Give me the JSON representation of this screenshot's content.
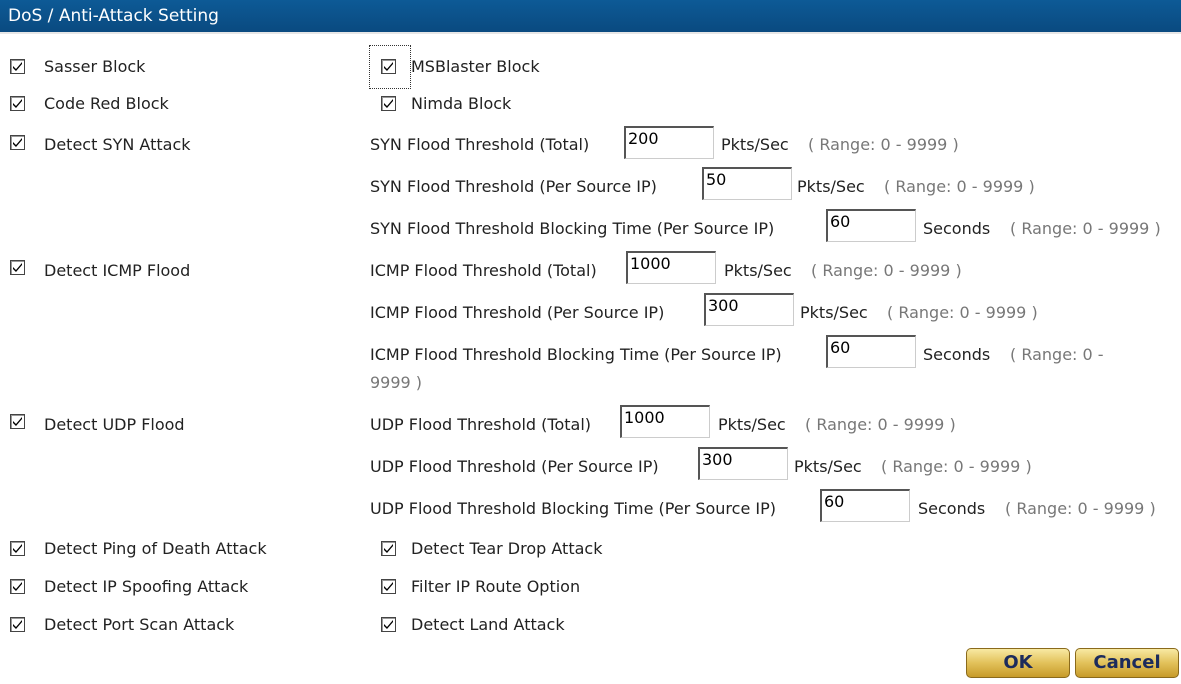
{
  "header": {
    "title": "DoS / Anti-Attack Setting"
  },
  "checks": {
    "sasser": "Sasser Block",
    "msblaster": "MSBlaster Block",
    "codered": "Code Red Block",
    "nimda": "Nimda Block",
    "syn": "Detect SYN Attack",
    "icmp": "Detect ICMP Flood",
    "udp": "Detect UDP Flood",
    "pingofdeath": "Detect Ping of Death Attack",
    "teardrop": "Detect Tear Drop Attack",
    "ipspoof": "Detect IP Spoofing Attack",
    "iproute": "Filter IP Route Option",
    "portscan": "Detect Port Scan Attack",
    "land": "Detect Land Attack"
  },
  "syn": {
    "total_label": "SYN Flood Threshold (Total)",
    "total_value": "200",
    "total_unit": "Pkts/Sec",
    "total_range": "( Range: 0 - 9999 )",
    "persrc_label": "SYN Flood Threshold (Per Source IP)",
    "persrc_value": "50",
    "persrc_unit": "Pkts/Sec",
    "persrc_range": "( Range: 0 - 9999 )",
    "block_label": "SYN Flood Threshold Blocking Time (Per Source IP)",
    "block_value": "60",
    "block_unit": "Seconds",
    "block_range": "( Range: 0 - 9999 )"
  },
  "icmp": {
    "total_label": "ICMP Flood Threshold (Total)",
    "total_value": "1000",
    "total_unit": "Pkts/Sec",
    "total_range": "( Range: 0 - 9999 )",
    "persrc_label": "ICMP Flood Threshold (Per Source IP)",
    "persrc_value": "300",
    "persrc_unit": "Pkts/Sec",
    "persrc_range": "( Range: 0 - 9999 )",
    "block_label": "ICMP Flood Threshold Blocking Time (Per Source IP)",
    "block_value": "60",
    "block_unit": "Seconds",
    "block_range_a": "( Range: 0 -",
    "block_range_b": "9999 )"
  },
  "udp": {
    "total_label": "UDP Flood Threshold (Total)",
    "total_value": "1000",
    "total_unit": "Pkts/Sec",
    "total_range": "( Range: 0 - 9999 )",
    "persrc_label": "UDP Flood Threshold (Per Source IP)",
    "persrc_value": "300",
    "persrc_unit": "Pkts/Sec",
    "persrc_range": "( Range: 0 - 9999 )",
    "block_label": "UDP Flood Threshold Blocking Time (Per Source IP)",
    "block_value": "60",
    "block_unit": "Seconds",
    "block_range": "( Range: 0 - 9999 )"
  },
  "buttons": {
    "ok": "OK",
    "cancel": "Cancel"
  },
  "icons": {
    "checkbox": "checkmark-icon"
  }
}
